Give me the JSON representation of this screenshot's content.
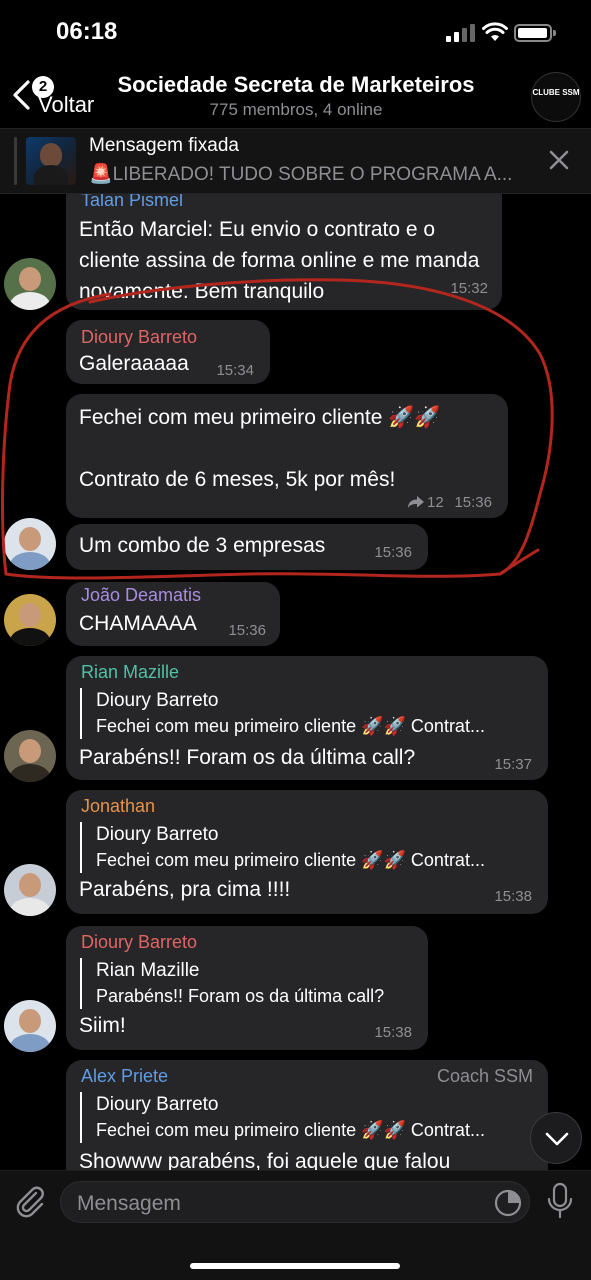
{
  "status_bar": {
    "time": "06:18"
  },
  "nav": {
    "back_badge": "2",
    "back_label": "Voltar",
    "title": "Sociedade Secreta de Marketeiros",
    "subtitle": "775 membros, 4 online",
    "avatar_text": "CLUBE SSM"
  },
  "pinned": {
    "title": "Mensagem fixada",
    "text": "🚨LIBERADO! TUDO SOBRE O PROGRAMA A..."
  },
  "colors": {
    "background": "#000000",
    "bubble": "#262628",
    "timestamp": "#8e8e93",
    "annotation": "#b3261e"
  },
  "messages": [
    {
      "sender": "Talan Pismel",
      "sender_color": "#5f9de6",
      "text": "Então Marciel: Eu envio o contrato e o cliente assina de forma online e me manda novamente. Bem tranquilo",
      "time": "15:32"
    },
    {
      "sender": "Dioury Barreto",
      "sender_color": "#e06464",
      "text": "Galeraaaaa",
      "time": "15:34"
    },
    {
      "text": "Fechei com meu primeiro cliente 🚀🚀\n\nContrato de 6 meses, 5k por mês!",
      "forwards": "12",
      "time": "15:36"
    },
    {
      "text": "Um combo de 3 empresas",
      "time": "15:36"
    },
    {
      "sender": "João Deamatis",
      "sender_color": "#a98de0",
      "text": "CHAMAAAA",
      "time": "15:36"
    },
    {
      "sender": "Rian Mazille",
      "sender_color": "#4fc1a6",
      "reply_name": "Dioury Barreto",
      "reply_text": "Fechei com meu primeiro cliente 🚀🚀 Contrat...",
      "text": "Parabéns!! Foram os da última call?",
      "time": "15:37"
    },
    {
      "sender": "Jonathan",
      "sender_color": "#e8924a",
      "reply_name": "Dioury Barreto",
      "reply_text": "Fechei com meu primeiro cliente 🚀🚀 Contrat...",
      "text": "Parabéns, pra cima !!!!",
      "time": "15:38"
    },
    {
      "sender": "Dioury Barreto",
      "sender_color": "#e06464",
      "reply_name": "Rian Mazille",
      "reply_text": "Parabéns!! Foram os da última call?",
      "text": "Siim!",
      "time": "15:38"
    },
    {
      "sender": "Alex Priete",
      "sender_color": "#5f9de6",
      "tag": "Coach SSM",
      "reply_name": "Dioury Barreto",
      "reply_text": "Fechei com meu primeiro cliente 🚀🚀 Contrat...",
      "text": "Showww parabéns, foi aquele que falou"
    }
  ],
  "input": {
    "placeholder": "Mensagem"
  }
}
